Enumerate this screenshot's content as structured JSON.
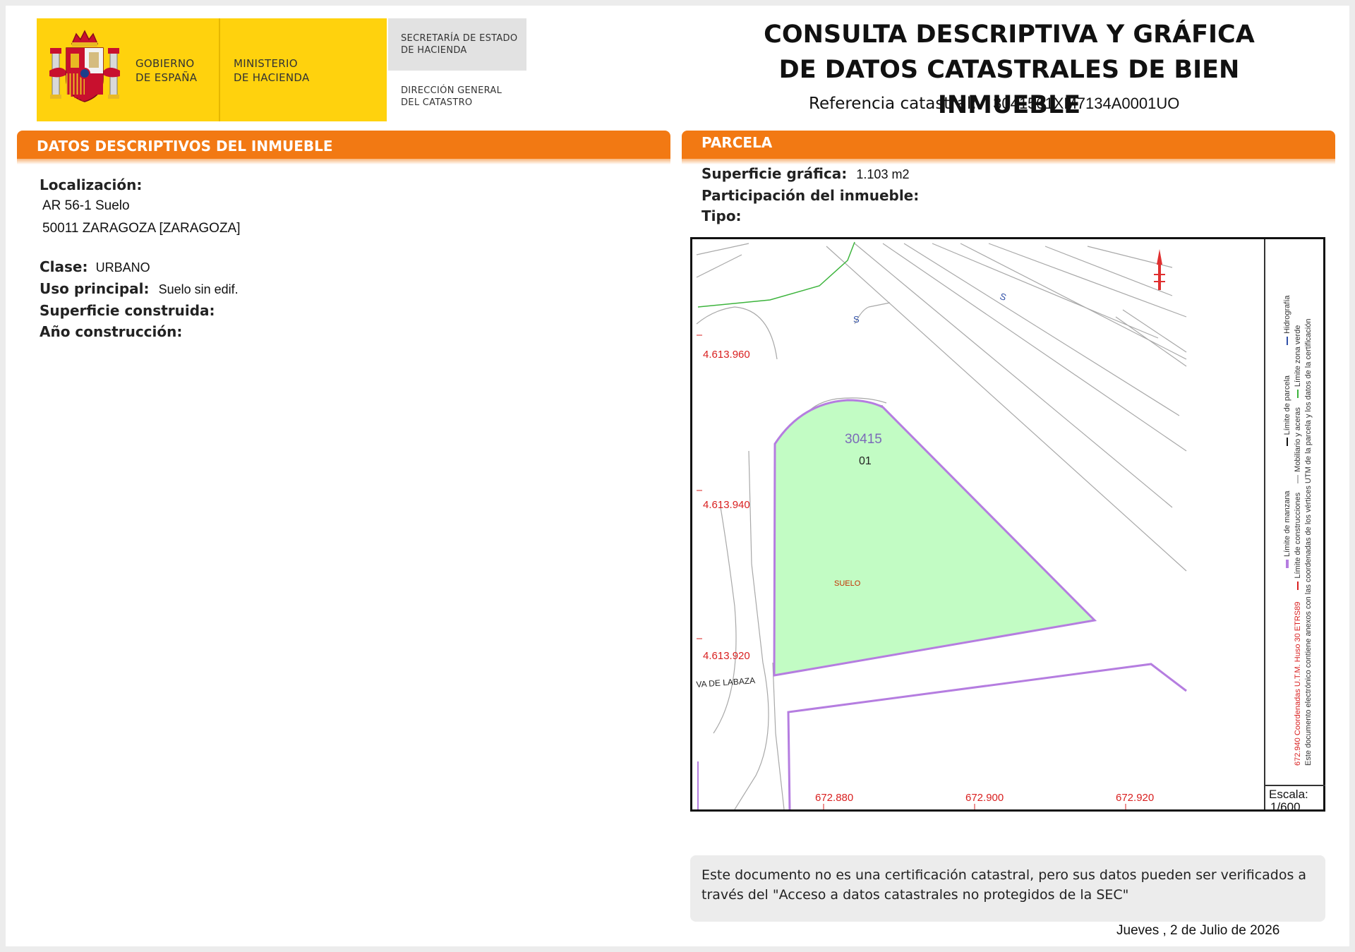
{
  "header": {
    "gobierno": [
      "GOBIERNO",
      "DE ESPAÑA"
    ],
    "ministerio": [
      "MINISTERIO",
      "DE HACIENDA"
    ],
    "secretaria": [
      "SECRETARÍA DE ESTADO",
      "DE HACIENDA"
    ],
    "direccion": [
      "DIRECCIÓN GENERAL",
      "DEL CATASTRO"
    ],
    "title_line1": "CONSULTA DESCRIPTIVA Y GRÁFICA",
    "title_line2": "DE DATOS CATASTRALES DE BIEN INMUEBLE",
    "ref_label": "Referencia catastral:",
    "ref_value": "3041501XM7134A0001UO"
  },
  "descriptivos": {
    "section_title": "DATOS DESCRIPTIVOS DEL INMUEBLE",
    "localizacion_label": "Localización:",
    "localizacion_line1": "AR 56-1  Suelo",
    "localizacion_line2": "50011 ZARAGOZA [ZARAGOZA]",
    "clase_label": "Clase:",
    "clase_value": "URBANO",
    "uso_label": "Uso principal:",
    "uso_value": "Suelo sin edif.",
    "superficie_label": "Superficie construida:",
    "anio_label": "Año construcción:"
  },
  "parcela": {
    "section_title": "PARCELA",
    "superficie_label": "Superficie gráfica:",
    "superficie_value": "1.103 m2",
    "participacion_label": "Participación del inmueble:",
    "tipo_label": "Tipo:"
  },
  "map": {
    "y_labels": [
      "4.613.960",
      "4.613.940",
      "4.613.920"
    ],
    "x_labels": [
      "672.880",
      "672.900",
      "672.920"
    ],
    "parcel_number": "30415",
    "subparcel_number": "01",
    "suelo_label": "SUELO",
    "street_label": "VA DE LABAZA",
    "s_marker": "S",
    "escala_label": "Escala:",
    "escala_value": "1/600",
    "legend": {
      "limite_manzana": "Límite de manzana",
      "limite_parcela": "Límite de parcela",
      "hidrografia": "Hidrografía",
      "limite_construcciones": "Límite de construcciones",
      "mobiliario": "Mobiliario y aceras",
      "limite_zona_verde": "Límite zona verde",
      "coords": "672.940 Coordenadas U.T.M. Huso 30 ETRS89",
      "doc_note": "Este documento electrónico contiene anexos con las coordenadas de los vértices UTM de la parcela y los datos de la certificación"
    },
    "colors": {
      "parcel_fill": "#c2fcc4",
      "parcel_border": "#b57de0",
      "coords_red": "#d92020",
      "green_line": "#3cb43c"
    }
  },
  "notice": {
    "line1": "Este documento no es una certificación catastral, pero sus datos pueden ser verificados a",
    "line2": "través del \"Acceso a datos catastrales no protegidos de la SEC\""
  },
  "date": "Jueves , 2 de Julio de 2026",
  "colors": {
    "orange": "#f27913",
    "yellow": "#ffd20d"
  }
}
